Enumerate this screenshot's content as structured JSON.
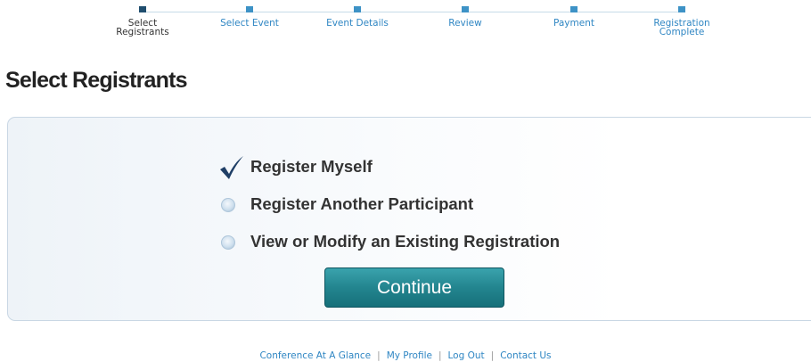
{
  "steps": [
    {
      "label": "Select\nRegistrants",
      "active": true
    },
    {
      "label": "Select Event",
      "active": false
    },
    {
      "label": "Event Details",
      "active": false
    },
    {
      "label": "Review",
      "active": false
    },
    {
      "label": "Payment",
      "active": false
    },
    {
      "label": "Registration\nComplete",
      "active": false
    }
  ],
  "page": {
    "title": "Select Registrants"
  },
  "options": [
    {
      "label": "Register Myself",
      "selected": true
    },
    {
      "label": "Register Another Participant",
      "selected": false
    },
    {
      "label": "View or Modify an Existing Registration",
      "selected": false
    }
  ],
  "continue_label": "Continue",
  "footer": {
    "links": [
      "Conference At A Glance",
      "My Profile",
      "Log Out",
      "Contact Us"
    ],
    "separator": "|"
  },
  "colors": {
    "link": "#2f86c3",
    "step_marker": "#3d92c6",
    "step_marker_active": "#1f4d6e",
    "button": "#23858f"
  }
}
